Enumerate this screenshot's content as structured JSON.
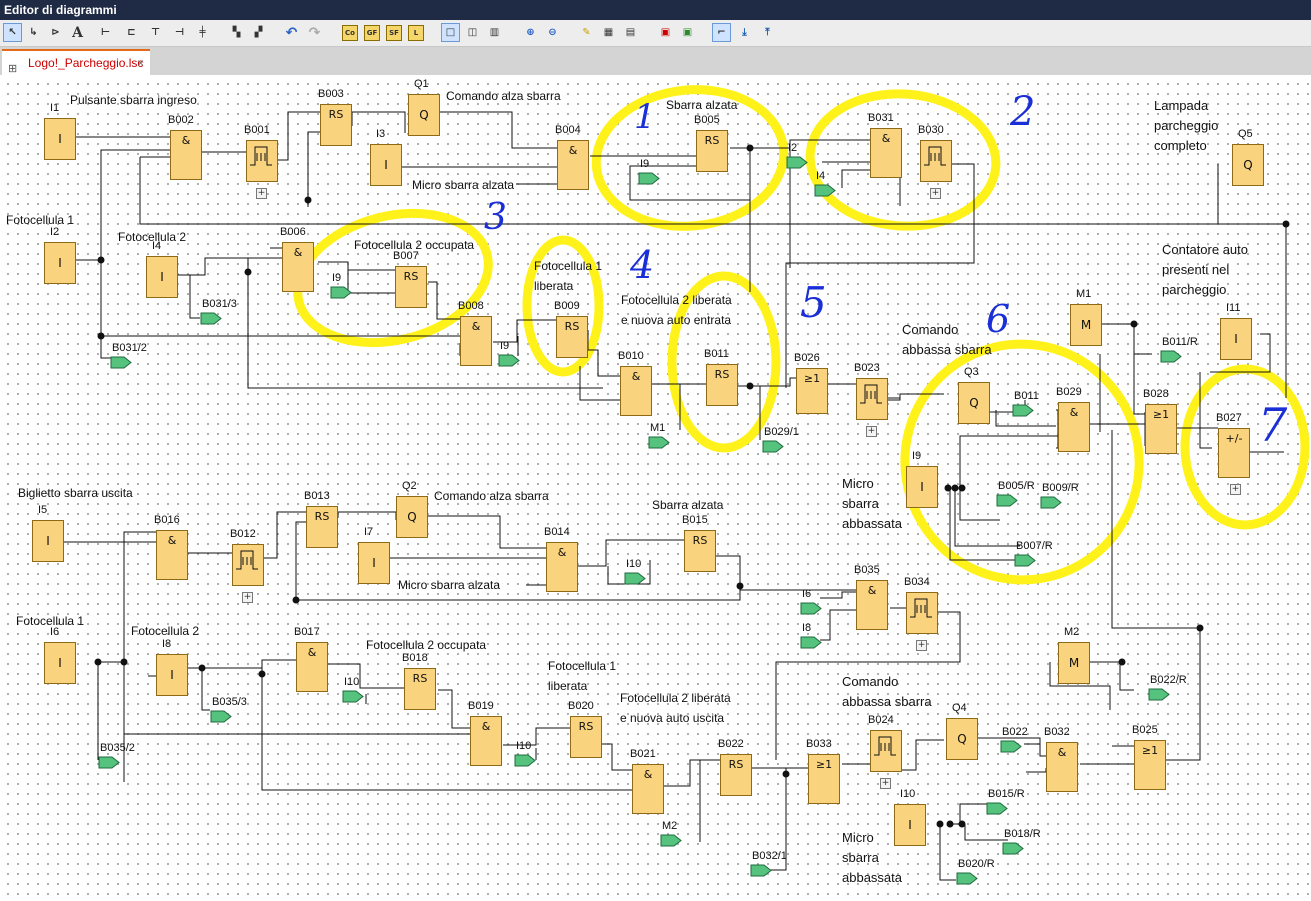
{
  "window": {
    "title": "Editor di diagrammi"
  },
  "toolbar": {
    "co": "Co",
    "gf": "GF",
    "sf": "SF",
    "l": "L"
  },
  "tab": {
    "title": "Logo!_Parcheggio.lsc",
    "close": "×"
  },
  "labels": {
    "pulsante_ingresso": "Pulsante sbarra ingreso",
    "comando_alza_1": "Comando alza sbarra",
    "micro_alzata_1": "Micro sbarra alzata",
    "sbarra_alzata_1": "Sbarra alzata",
    "lampada": "Lampada\nparcheggio\ncompleto",
    "fotocellula1_a": "Fotocellula 1",
    "fotocellula2_a": "Fotocellula 2",
    "fc2_occupata_a": "Fotocellula 2 occupata",
    "fc1_liberata_a": "Fotocellula 1\nliberata",
    "fc2_liberata_entrata": "Fotocellula 2 liberata\ne nuova auto entrata",
    "contatore": "Contatore auto\npresenti nel\nparcheggio",
    "comando_abbassa_1": "Comando\nabbassa sbarra",
    "micro_abbassata_1": "Micro\nsbarra\nabbassata",
    "biglietto": "Biglietto sbarra uscita",
    "comando_alza_2": "Comando alza sbarra",
    "sbarra_alzata_2": "Sbarra alzata",
    "micro_alzata_2": "Micro sbarra alzata",
    "fotocellula1_b": "Fotocellula 1",
    "fotocellula2_b": "Fotocellula 2",
    "fc2_occupata_b": "Fotocellula 2 occupata",
    "fc1_liberata_b": "Fotocellula 1\nliberata",
    "fc2_liberata_uscita": "Fotocellula 2 liberata\ne nuova auto uscita",
    "comando_abbassa_2": "Comando\nabbassa sbarra",
    "micro_abbassata_2": "Micro\nsbarra\nabbassata"
  },
  "blocks": {
    "I1": {
      "name": "I1",
      "sym": "I"
    },
    "I2": {
      "name": "I2",
      "sym": "I"
    },
    "I3": {
      "name": "I3",
      "sym": "I"
    },
    "I4": {
      "name": "I4",
      "sym": "I"
    },
    "I5": {
      "name": "I5",
      "sym": "I"
    },
    "I6": {
      "name": "I6",
      "sym": "I"
    },
    "I7": {
      "name": "I7",
      "sym": "I"
    },
    "I8": {
      "name": "I8",
      "sym": "I"
    },
    "I9": {
      "name": "I9",
      "sym": "I"
    },
    "I10": {
      "name": "I10",
      "sym": "I"
    },
    "I11": {
      "name": "I11",
      "sym": "I"
    },
    "Q1": {
      "name": "Q1",
      "sym": "Q"
    },
    "Q2": {
      "name": "Q2",
      "sym": "Q"
    },
    "Q3": {
      "name": "Q3",
      "sym": "Q"
    },
    "Q4": {
      "name": "Q4",
      "sym": "Q"
    },
    "Q5": {
      "name": "Q5",
      "sym": "Q"
    },
    "M1": {
      "name": "M1",
      "sym": "M"
    },
    "M2": {
      "name": "M2",
      "sym": "M"
    },
    "B001": {
      "name": "B001"
    },
    "B002": {
      "name": "B002",
      "sym": "&"
    },
    "B003": {
      "name": "B003",
      "sym": "RS"
    },
    "B004": {
      "name": "B004",
      "sym": "&"
    },
    "B005": {
      "name": "B005",
      "sym": "RS"
    },
    "B006": {
      "name": "B006",
      "sym": "&"
    },
    "B007": {
      "name": "B007",
      "sym": "RS"
    },
    "B008": {
      "name": "B008",
      "sym": "&"
    },
    "B009": {
      "name": "B009",
      "sym": "RS"
    },
    "B010": {
      "name": "B010",
      "sym": "&"
    },
    "B011": {
      "name": "B011",
      "sym": "RS"
    },
    "B012": {
      "name": "B012"
    },
    "B013": {
      "name": "B013",
      "sym": "RS"
    },
    "B014": {
      "name": "B014",
      "sym": "&"
    },
    "B015": {
      "name": "B015",
      "sym": "RS"
    },
    "B016": {
      "name": "B016",
      "sym": "&"
    },
    "B017": {
      "name": "B017",
      "sym": "&"
    },
    "B018": {
      "name": "B018",
      "sym": "RS"
    },
    "B019": {
      "name": "B019",
      "sym": "&"
    },
    "B020": {
      "name": "B020",
      "sym": "RS"
    },
    "B021": {
      "name": "B021",
      "sym": "&"
    },
    "B022": {
      "name": "B022",
      "sym": "RS"
    },
    "B023": {
      "name": "B023"
    },
    "B024": {
      "name": "B024"
    },
    "B025": {
      "name": "B025",
      "sym": "≥1"
    },
    "B026": {
      "name": "B026",
      "sym": "≥1"
    },
    "B027": {
      "name": "B027",
      "sym": "+/-"
    },
    "B028": {
      "name": "B028",
      "sym": "≥1"
    },
    "B029": {
      "name": "B029",
      "sym": "&"
    },
    "B030": {
      "name": "B030"
    },
    "B031": {
      "name": "B031",
      "sym": "&"
    },
    "B032": {
      "name": "B032",
      "sym": "&"
    },
    "B033": {
      "name": "B033",
      "sym": "≥1"
    },
    "B034": {
      "name": "B034"
    },
    "B035": {
      "name": "B035",
      "sym": "&"
    }
  },
  "connectors": {
    "c_B031_3": "B031/3",
    "c_B031_2": "B031/2",
    "c_I9_a": "I9",
    "c_I9_b": "I9",
    "c_I9_c": "I9",
    "c_I2": "I2",
    "c_I4": "I4",
    "c_M1": "M1",
    "c_B029_1": "B029/1",
    "c_B011": "B011",
    "c_B011_R": "B011/R",
    "c_B005_R": "B005/R",
    "c_B009_R": "B009/R",
    "c_B007_R": "B007/R",
    "c_I10_a": "I10",
    "c_I10_b": "I10",
    "c_I10_c": "I10",
    "c_I6": "I6",
    "c_I8": "I8",
    "c_B035_3": "B035/3",
    "c_B035_2": "B035/2",
    "c_M2": "M2",
    "c_B032_1": "B032/1",
    "c_B022": "B022",
    "c_B022_R": "B022/R",
    "c_B015_R": "B015/R",
    "c_B018_R": "B018/R",
    "c_B020_R": "B020/R"
  },
  "annotations": {
    "n1": "1",
    "n2": "2",
    "n3": "3",
    "n4": "4",
    "n5": "5",
    "n6": "6",
    "n7": "7"
  },
  "colors": {
    "block_fill": "#fad37e",
    "connector_fill": "#55c27e",
    "highlight": "#fff21a",
    "ink": "#1a2fd6",
    "tab_accent": "#e26b1b"
  }
}
